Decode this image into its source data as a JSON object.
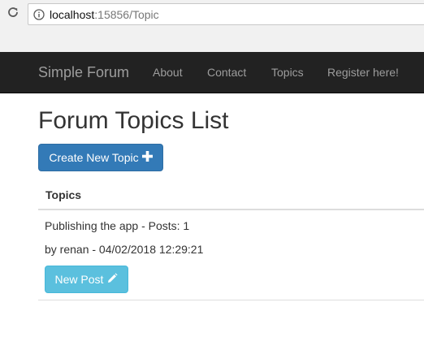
{
  "browser": {
    "url_host": "localhost",
    "url_path": ":15856/Topic"
  },
  "navbar": {
    "brand": "Simple Forum",
    "links": [
      "About",
      "Contact",
      "Topics",
      "Register here!"
    ]
  },
  "main": {
    "title": "Forum Topics List",
    "create_button_label": "Create New Topic",
    "table_header": "Topics",
    "topics": [
      {
        "summary": "Publishing the app - Posts: 1",
        "meta": "by renan - 04/02/2018 12:29:21",
        "new_post_label": "New Post"
      }
    ]
  },
  "colors": {
    "navbar_bg": "#222222",
    "primary": "#337ab7",
    "info": "#5bc0de"
  },
  "icons": {
    "reload": "reload-icon",
    "info": "info-icon",
    "create": "plus-icon",
    "new_post": "pencil-icon"
  }
}
